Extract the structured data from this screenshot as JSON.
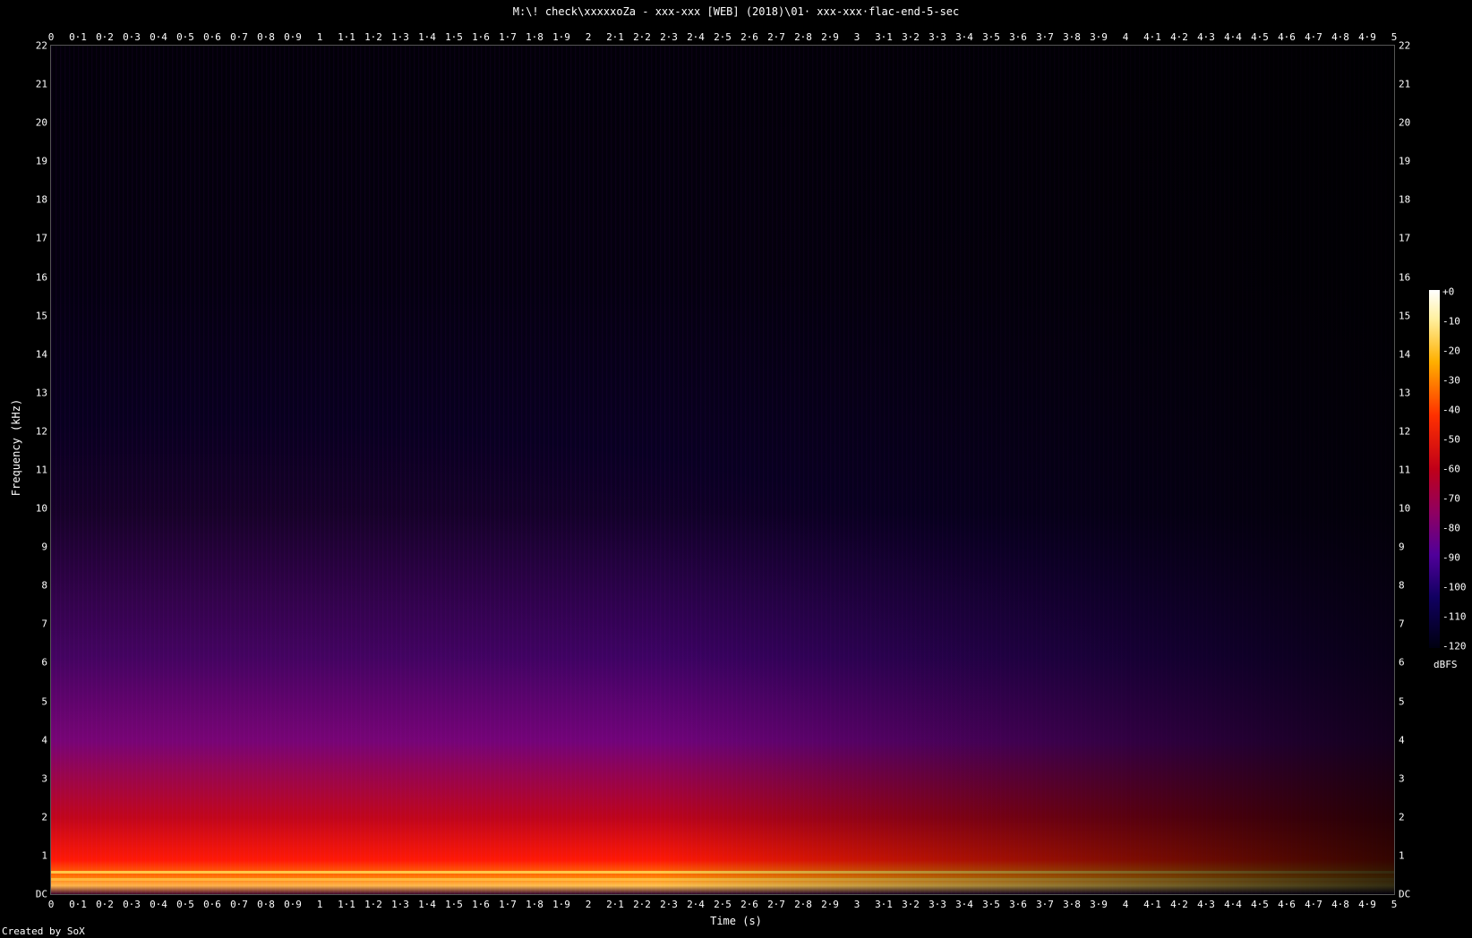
{
  "chart_data": {
    "type": "heatmap",
    "title": "M:\\! check\\xxxxxoZa - xxx-xxx [WEB] (2018)\\01· xxx-xxx·flac-end-5-sec",
    "xlabel": "Time (s)",
    "ylabel": "Frequency (kHz)",
    "xlim": [
      0,
      5
    ],
    "ylim": [
      0,
      22
    ],
    "x_ticks": [
      "0",
      "0·1",
      "0·2",
      "0·3",
      "0·4",
      "0·5",
      "0·6",
      "0·7",
      "0·8",
      "0·9",
      "1",
      "1·1",
      "1·2",
      "1·3",
      "1·4",
      "1·5",
      "1·6",
      "1·7",
      "1·8",
      "1·9",
      "2",
      "2·1",
      "2·2",
      "2·3",
      "2·4",
      "2·5",
      "2·6",
      "2·7",
      "2·8",
      "2·9",
      "3",
      "3·1",
      "3·2",
      "3·3",
      "3·4",
      "3·5",
      "3·6",
      "3·7",
      "3·8",
      "3·9",
      "4",
      "4·1",
      "4·2",
      "4·3",
      "4·4",
      "4·5",
      "4·6",
      "4·7",
      "4·8",
      "4·9",
      "5"
    ],
    "y_ticks": [
      "DC",
      "1",
      "2",
      "3",
      "4",
      "5",
      "6",
      "7",
      "8",
      "9",
      "10",
      "11",
      "12",
      "13",
      "14",
      "15",
      "16",
      "17",
      "18",
      "19",
      "20",
      "21",
      "22"
    ],
    "colorbar": {
      "ticks": [
        "+0",
        "-10",
        "-20",
        "-30",
        "-40",
        "-50",
        "-60",
        "-70",
        "-80",
        "-90",
        "-100",
        "-110",
        "-120"
      ],
      "unit": "dBFS",
      "range": [
        -120,
        0
      ]
    },
    "footer": "Created by SoX"
  }
}
